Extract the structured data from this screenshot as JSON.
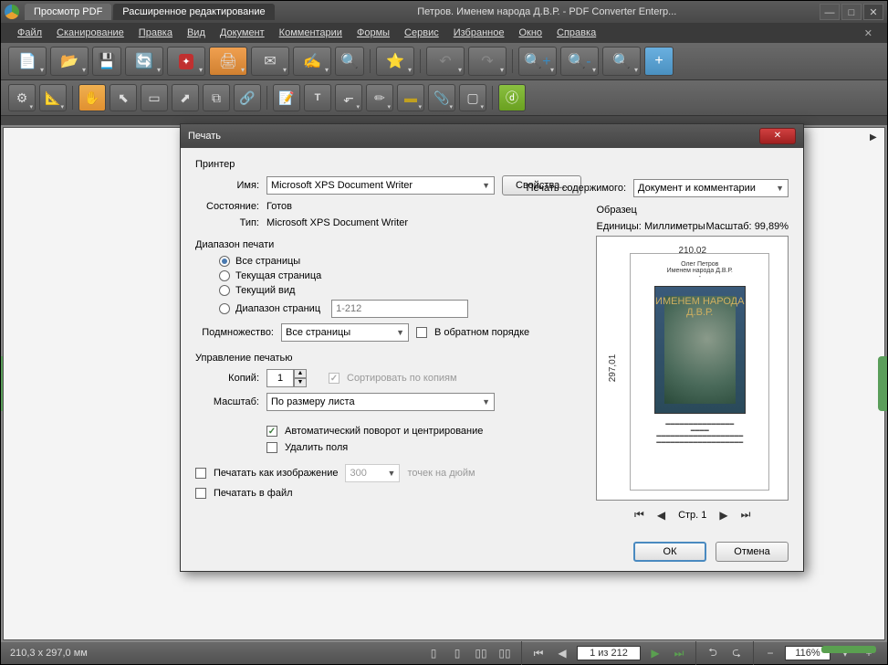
{
  "titlebar": {
    "tabs": [
      "Просмотр PDF",
      "Расширенное редактирование"
    ],
    "title": "Петров. Именем народа Д.В.Р. - PDF Converter Enterp..."
  },
  "menu": {
    "items": [
      "Файл",
      "Сканирование",
      "Правка",
      "Вид",
      "Документ",
      "Комментарии",
      "Формы",
      "Сервис",
      "Избранное",
      "Окно",
      "Справка"
    ]
  },
  "statusbar": {
    "dims": "210,3 x 297,0 мм",
    "page": "1 из 212",
    "zoom": "116%"
  },
  "dialog": {
    "title": "Печать",
    "printer_section": "Принтер",
    "name_label": "Имя:",
    "name_value": "Microsoft XPS Document Writer",
    "properties_btn": "Свойства...",
    "status_label": "Состояние:",
    "status_value": "Готов",
    "type_label": "Тип:",
    "type_value": "Microsoft XPS Document Writer",
    "content_label": "Печать содержимого:",
    "content_value": "Документ и комментарии",
    "range_section": "Диапазон печати",
    "range_all": "Все страницы",
    "range_current_page": "Текущая страница",
    "range_current_view": "Текущий вид",
    "range_pages": "Диапазон страниц",
    "range_placeholder": "1-212",
    "subset_label": "Подмножество:",
    "subset_value": "Все страницы",
    "reverse_label": "В обратном порядке",
    "handling_section": "Управление печатью",
    "copies_label": "Копий:",
    "copies_value": "1",
    "collate_label": "Сортировать по копиям",
    "scale_label": "Масштаб:",
    "scale_value": "По размеру листа",
    "autorotate_label": "Автоматический поворот и центрирование",
    "remove_margins_label": "Удалить поля",
    "print_as_image_label": "Печатать как изображение",
    "dpi_value": "300",
    "dpi_unit": "точек на дюйм",
    "print_to_file_label": "Печатать в файл",
    "preview_section": "Образец",
    "units_label": "Единицы:",
    "units_value": "Миллиметры",
    "preview_scale_label": "Масштаб:",
    "preview_scale_value": "99,89%",
    "page_width": "210,02",
    "page_height": "297,01",
    "cover_author": "Олег Петров",
    "cover_title_line": "Именем народа Д.В.Р.",
    "cover_big1": "ИМЕНЕМ НАРОДА",
    "cover_big2": "Д.В.Р.",
    "page_nav": "Стр. 1",
    "ok_btn": "ОК",
    "cancel_btn": "Отмена"
  }
}
